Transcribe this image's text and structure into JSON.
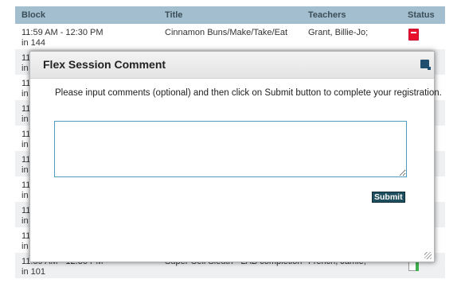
{
  "table": {
    "headers": {
      "block": "Block",
      "title": "Title",
      "teachers": "Teachers",
      "status": "Status"
    },
    "first_row": {
      "block_time": "11:59 AM - 12:30 PM",
      "block_room": "in 144",
      "title": "Cinnamon Buns/Make/Take/Eat",
      "teachers": "Grant, Billie-Jo;",
      "status_icon": "registered-red-icon"
    },
    "partial_rows": [
      {
        "line1": "11",
        "line2": "in"
      },
      {
        "line1": "11",
        "line2": "in"
      },
      {
        "line1": "11",
        "line2": "in"
      },
      {
        "line1": "11",
        "line2": "in"
      },
      {
        "line1": "11",
        "line2": "in"
      },
      {
        "line1": "11",
        "line2": "in"
      },
      {
        "line1": "11",
        "line2": "in"
      },
      {
        "line1": "11",
        "line2": "in"
      }
    ],
    "last_row": {
      "block_time": "11:59 AM - 12:30 PM",
      "block_room": "in 101",
      "title": "Super Cell Sleuth - LAB completion",
      "teachers": "French, Jamie;",
      "status_icon": "available-green-icon"
    }
  },
  "modal": {
    "title": "Flex Session Comment",
    "message": "Please input comments (optional) and then click on Submit button to complete your registration.",
    "comment_value": "",
    "submit_label": "Submit",
    "close_icon": "close-icon"
  },
  "colors": {
    "header_bg": "#a3bfcf",
    "submit_bg": "#1f4e5e",
    "input_border": "#4f9dbd",
    "status_red": "#e8112d",
    "status_green": "#3fb34f"
  }
}
